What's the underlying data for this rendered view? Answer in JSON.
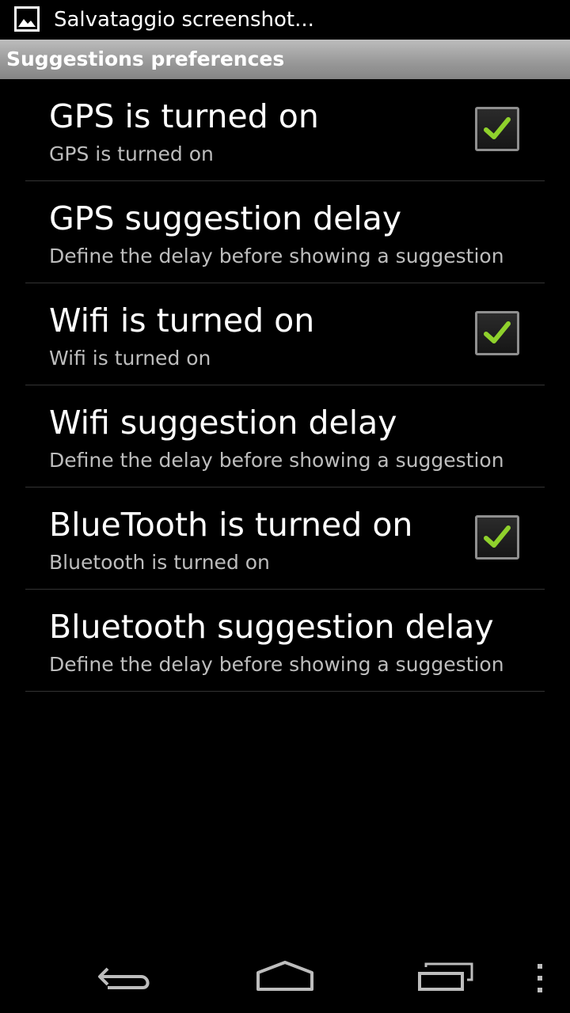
{
  "status_bar": {
    "notification_icon": "image-icon",
    "notification_text": "Salvataggio screenshot..."
  },
  "header": {
    "title": "Suggestions preferences"
  },
  "preferences": [
    {
      "title": "GPS is turned on",
      "summary": "GPS is turned on",
      "has_checkbox": true,
      "checked": true
    },
    {
      "title": "GPS suggestion delay",
      "summary": "Define the delay before showing a suggestion",
      "has_checkbox": false
    },
    {
      "title": "Wifi is turned on",
      "summary": "Wifi is turned on",
      "has_checkbox": true,
      "checked": true
    },
    {
      "title": "Wifi suggestion delay",
      "summary": "Define the delay before showing a suggestion",
      "has_checkbox": false
    },
    {
      "title": "BlueTooth is turned on",
      "summary": "Bluetooth is turned on",
      "has_checkbox": true,
      "checked": true
    },
    {
      "title": "Bluetooth suggestion delay",
      "summary": "Define the delay before showing a suggestion",
      "has_checkbox": false
    }
  ],
  "nav_bar": {
    "back_icon": "back-icon",
    "home_icon": "home-icon",
    "recents_icon": "recents-icon",
    "menu_icon": "overflow-menu-icon"
  },
  "colors": {
    "check_mark": "#8fd12c",
    "summary_text": "#bdbdbd",
    "divider": "#333333"
  }
}
